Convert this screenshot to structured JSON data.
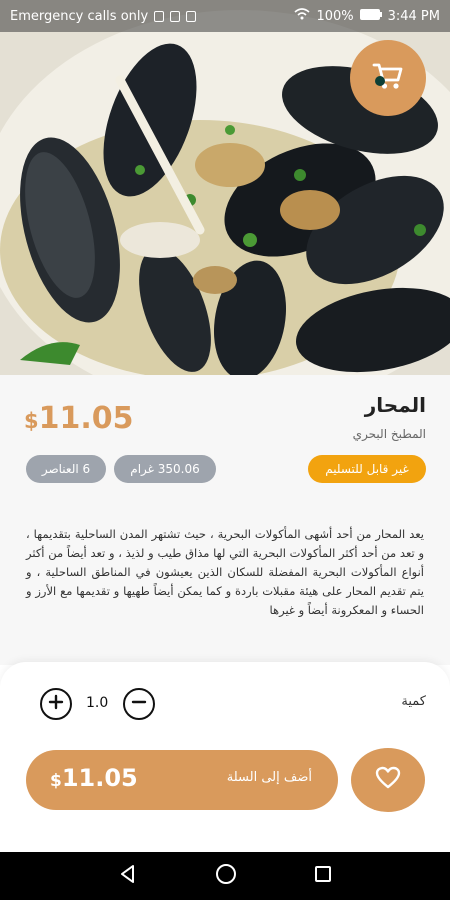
{
  "status_bar": {
    "carrier": "Emergency calls only",
    "battery": "100%",
    "time": "3:44 PM"
  },
  "product": {
    "name": "المحار",
    "category": "المطبخ البحري",
    "price_currency": "$",
    "price_amount": "11.05",
    "badges": {
      "delivery": "غير قابل للتسليم",
      "weight": "350.06 غرام",
      "items": "6 العناصر"
    },
    "description": "يعد المحار من أحد أشهى المأكولات البحرية ، حيث تشتهر المدن الساحلية بتقديمها ، و تعد من أحد أكثر المأكولات البحرية التي لها مذاق طيب و لذيذ ، و تعد أيضاً من أكثر أنواع المأكولات البحرية المفضلة للسكان الذين يعيشون في المناطق الساحلية ، و يتم تقديم المحار على هيئة مقبلات باردة و كما يمكن أيضاً طهيها و تقديمها مع الأرز و الحساء و المعكرونة أيضاً و غيرها"
  },
  "order": {
    "quantity_label": "كمية",
    "quantity_value": "1.0",
    "add_to_cart_label": "أضف إلى السلة",
    "total_currency": "$",
    "total_amount": "11.05"
  },
  "icons": {
    "cart": "cart-icon",
    "plus": "plus-circle-icon",
    "minus": "minus-circle-icon",
    "favorite": "heart-icon",
    "back": "back-triangle-icon",
    "home": "home-circle-icon",
    "recents": "recents-square-icon"
  },
  "colors": {
    "accent": "#d99a5c",
    "delivery_badge": "#f2a30f",
    "grey_badge": "#9ea4ad"
  }
}
